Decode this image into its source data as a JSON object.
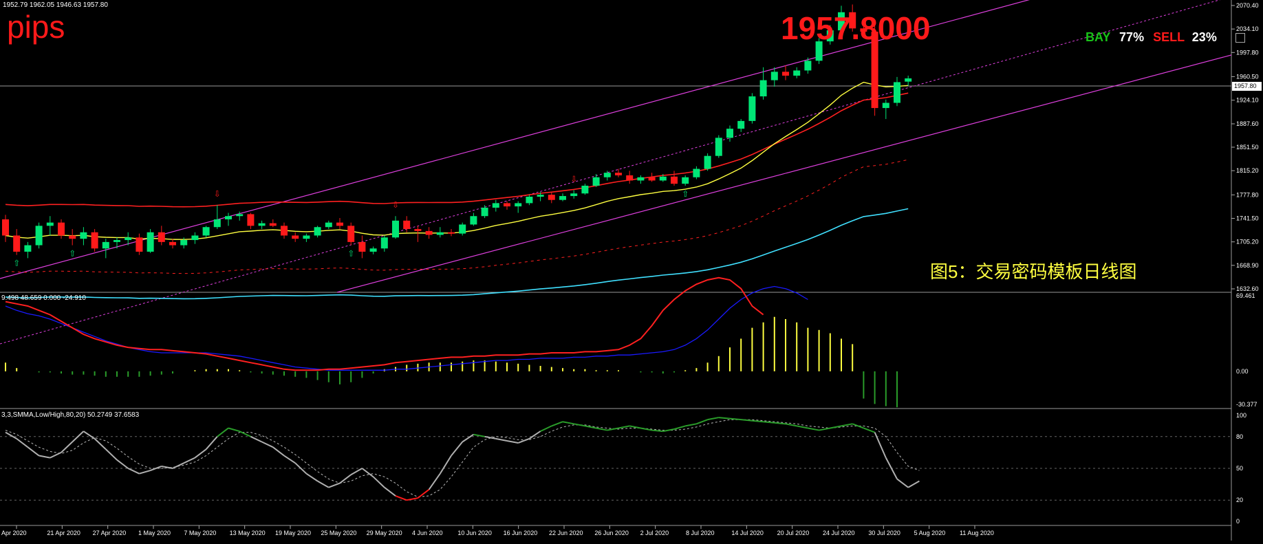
{
  "terminal": {
    "ohlc_readout": "1952.79 1962.05 1946.63 1957.80",
    "pips_label": "pips",
    "big_price": "1957.8000",
    "sentiment": {
      "buy_label": "BAY",
      "buy_pct": "77%",
      "sell_label": "SELL",
      "sell_pct": "23%"
    },
    "caption": "图5：交易密码模板日线图",
    "current_price_tag": "1957.80"
  },
  "colors": {
    "background": "#000000",
    "bull": "#00e676",
    "bear": "#ff1a1a",
    "ma_long": "#ff2020",
    "ma_mid": "#ffff40",
    "ma_low": "#40e0ff",
    "channel": "#e040e0",
    "macd_line": "#1a1aff",
    "signal_line": "#ff2020",
    "stoch_main": "#b0b0b0",
    "stoch_strong": "#2a9d2a",
    "axis_text": "#ffffff"
  },
  "price_axis": {
    "ticks": [
      "2070.40",
      "2034.10",
      "1997.80",
      "1960.50",
      "1924.10",
      "1887.60",
      "1851.50",
      "1815.20",
      "1777.80",
      "1741.50",
      "1705.20",
      "1668.90",
      "1632.60"
    ]
  },
  "macd_panel": {
    "header": "9.498 48.659 0.000 -24.910",
    "ticks": [
      "69.461",
      "0.00",
      "-30.377"
    ]
  },
  "stoch_panel": {
    "header": "3,3,SMMA,Low/High,80,20) 50.2749 37.6583",
    "ticks": [
      "100",
      "80",
      "50",
      "20",
      "0"
    ]
  },
  "date_axis": [
    "Apr 2020",
    "21 Apr 2020",
    "27 Apr 2020",
    "1 May 2020",
    "7 May 2020",
    "13 May 2020",
    "19 May 2020",
    "25 May 2020",
    "29 May 2020",
    "4 Jun 2020",
    "10 Jun 2020",
    "16 Jun 2020",
    "22 Jun 2020",
    "26 Jun 2020",
    "2 Jul 2020",
    "8 Jul 2020",
    "14 Jul 2020",
    "20 Jul 2020",
    "24 Jul 2020",
    "30 Jul 2020",
    "5 Aug 2020",
    "11 Aug 2020"
  ],
  "chart_data": {
    "type": "candlestick",
    "symbol_timeframe": "daily",
    "ylim": [
      1632.6,
      2070.4
    ],
    "candles": [
      {
        "o": 1740,
        "h": 1747,
        "l": 1705,
        "c": 1715
      },
      {
        "o": 1715,
        "h": 1725,
        "l": 1685,
        "c": 1690
      },
      {
        "o": 1690,
        "h": 1705,
        "l": 1680,
        "c": 1700
      },
      {
        "o": 1700,
        "h": 1735,
        "l": 1695,
        "c": 1730
      },
      {
        "o": 1730,
        "h": 1745,
        "l": 1715,
        "c": 1735
      },
      {
        "o": 1735,
        "h": 1740,
        "l": 1710,
        "c": 1715
      },
      {
        "o": 1715,
        "h": 1725,
        "l": 1700,
        "c": 1710
      },
      {
        "o": 1710,
        "h": 1728,
        "l": 1700,
        "c": 1720
      },
      {
        "o": 1720,
        "h": 1725,
        "l": 1690,
        "c": 1695
      },
      {
        "o": 1695,
        "h": 1710,
        "l": 1680,
        "c": 1705
      },
      {
        "o": 1705,
        "h": 1712,
        "l": 1695,
        "c": 1708
      },
      {
        "o": 1708,
        "h": 1720,
        "l": 1700,
        "c": 1712
      },
      {
        "o": 1712,
        "h": 1718,
        "l": 1685,
        "c": 1690
      },
      {
        "o": 1690,
        "h": 1725,
        "l": 1688,
        "c": 1720
      },
      {
        "o": 1720,
        "h": 1730,
        "l": 1700,
        "c": 1705
      },
      {
        "o": 1705,
        "h": 1710,
        "l": 1695,
        "c": 1700
      },
      {
        "o": 1700,
        "h": 1712,
        "l": 1695,
        "c": 1708
      },
      {
        "o": 1708,
        "h": 1720,
        "l": 1702,
        "c": 1715
      },
      {
        "o": 1715,
        "h": 1730,
        "l": 1712,
        "c": 1728
      },
      {
        "o": 1728,
        "h": 1762,
        "l": 1725,
        "c": 1740
      },
      {
        "o": 1740,
        "h": 1750,
        "l": 1730,
        "c": 1745
      },
      {
        "o": 1745,
        "h": 1752,
        "l": 1738,
        "c": 1748
      },
      {
        "o": 1748,
        "h": 1750,
        "l": 1725,
        "c": 1730
      },
      {
        "o": 1730,
        "h": 1738,
        "l": 1725,
        "c": 1734
      },
      {
        "o": 1734,
        "h": 1740,
        "l": 1728,
        "c": 1730
      },
      {
        "o": 1730,
        "h": 1735,
        "l": 1710,
        "c": 1715
      },
      {
        "o": 1715,
        "h": 1720,
        "l": 1705,
        "c": 1710
      },
      {
        "o": 1710,
        "h": 1718,
        "l": 1705,
        "c": 1715
      },
      {
        "o": 1715,
        "h": 1730,
        "l": 1712,
        "c": 1728
      },
      {
        "o": 1728,
        "h": 1738,
        "l": 1725,
        "c": 1735
      },
      {
        "o": 1735,
        "h": 1742,
        "l": 1725,
        "c": 1730
      },
      {
        "o": 1730,
        "h": 1735,
        "l": 1700,
        "c": 1705
      },
      {
        "o": 1705,
        "h": 1715,
        "l": 1680,
        "c": 1690
      },
      {
        "o": 1690,
        "h": 1698,
        "l": 1686,
        "c": 1695
      },
      {
        "o": 1695,
        "h": 1715,
        "l": 1690,
        "c": 1712
      },
      {
        "o": 1712,
        "h": 1745,
        "l": 1710,
        "c": 1738
      },
      {
        "o": 1738,
        "h": 1745,
        "l": 1720,
        "c": 1725
      },
      {
        "o": 1725,
        "h": 1730,
        "l": 1705,
        "c": 1722
      },
      {
        "o": 1722,
        "h": 1728,
        "l": 1710,
        "c": 1716
      },
      {
        "o": 1716,
        "h": 1728,
        "l": 1712,
        "c": 1720
      },
      {
        "o": 1720,
        "h": 1725,
        "l": 1714,
        "c": 1718
      },
      {
        "o": 1718,
        "h": 1735,
        "l": 1715,
        "c": 1732
      },
      {
        "o": 1732,
        "h": 1750,
        "l": 1730,
        "c": 1745
      },
      {
        "o": 1745,
        "h": 1762,
        "l": 1742,
        "c": 1758
      },
      {
        "o": 1758,
        "h": 1770,
        "l": 1752,
        "c": 1765
      },
      {
        "o": 1765,
        "h": 1768,
        "l": 1755,
        "c": 1760
      },
      {
        "o": 1760,
        "h": 1768,
        "l": 1750,
        "c": 1765
      },
      {
        "o": 1765,
        "h": 1778,
        "l": 1762,
        "c": 1775
      },
      {
        "o": 1775,
        "h": 1782,
        "l": 1768,
        "c": 1778
      },
      {
        "o": 1778,
        "h": 1782,
        "l": 1765,
        "c": 1770
      },
      {
        "o": 1770,
        "h": 1780,
        "l": 1768,
        "c": 1776
      },
      {
        "o": 1776,
        "h": 1785,
        "l": 1772,
        "c": 1780
      },
      {
        "o": 1780,
        "h": 1795,
        "l": 1778,
        "c": 1792
      },
      {
        "o": 1792,
        "h": 1810,
        "l": 1790,
        "c": 1805
      },
      {
        "o": 1805,
        "h": 1815,
        "l": 1800,
        "c": 1812
      },
      {
        "o": 1812,
        "h": 1818,
        "l": 1805,
        "c": 1808
      },
      {
        "o": 1808,
        "h": 1815,
        "l": 1795,
        "c": 1800
      },
      {
        "o": 1800,
        "h": 1808,
        "l": 1795,
        "c": 1805
      },
      {
        "o": 1805,
        "h": 1812,
        "l": 1798,
        "c": 1800
      },
      {
        "o": 1800,
        "h": 1810,
        "l": 1798,
        "c": 1806
      },
      {
        "o": 1806,
        "h": 1815,
        "l": 1792,
        "c": 1795
      },
      {
        "o": 1795,
        "h": 1808,
        "l": 1792,
        "c": 1805
      },
      {
        "o": 1805,
        "h": 1822,
        "l": 1802,
        "c": 1818
      },
      {
        "o": 1818,
        "h": 1842,
        "l": 1815,
        "c": 1838
      },
      {
        "o": 1838,
        "h": 1870,
        "l": 1835,
        "c": 1866
      },
      {
        "o": 1866,
        "h": 1885,
        "l": 1860,
        "c": 1880
      },
      {
        "o": 1880,
        "h": 1895,
        "l": 1875,
        "c": 1892
      },
      {
        "o": 1892,
        "h": 1935,
        "l": 1888,
        "c": 1930
      },
      {
        "o": 1930,
        "h": 1975,
        "l": 1925,
        "c": 1955
      },
      {
        "o": 1955,
        "h": 1975,
        "l": 1945,
        "c": 1968
      },
      {
        "o": 1968,
        "h": 1978,
        "l": 1955,
        "c": 1962
      },
      {
        "o": 1962,
        "h": 1975,
        "l": 1958,
        "c": 1970
      },
      {
        "o": 1970,
        "h": 1990,
        "l": 1965,
        "c": 1985
      },
      {
        "o": 1985,
        "h": 2020,
        "l": 1980,
        "c": 2015
      },
      {
        "o": 2015,
        "h": 2040,
        "l": 2010,
        "c": 2032
      },
      {
        "o": 2032,
        "h": 2070,
        "l": 2028,
        "c": 2060
      },
      {
        "o": 2060,
        "h": 2072,
        "l": 2030,
        "c": 2035
      },
      {
        "o": 2035,
        "h": 2050,
        "l": 2025,
        "c": 2030
      },
      {
        "o": 2030,
        "h": 2040,
        "l": 1900,
        "c": 1912
      },
      {
        "o": 1912,
        "h": 1925,
        "l": 1895,
        "c": 1920
      },
      {
        "o": 1920,
        "h": 1960,
        "l": 1915,
        "c": 1952
      },
      {
        "o": 1952.79,
        "h": 1962.05,
        "l": 1946.63,
        "c": 1957.8
      }
    ],
    "macd_bars": [
      8,
      3,
      0,
      -1,
      -1,
      -2,
      -3,
      -3,
      -4,
      -5,
      -5,
      -5,
      -5,
      -4,
      -3,
      -2,
      0,
      1,
      2,
      2,
      2,
      1,
      -1,
      -2,
      -3,
      -4,
      -5,
      -6,
      -8,
      -10,
      -12,
      -10,
      -6,
      -2,
      2,
      4,
      6,
      7,
      8,
      8,
      8,
      9,
      10,
      10,
      9,
      8,
      7,
      6,
      5,
      4,
      3,
      2,
      2,
      1,
      1,
      1,
      0,
      -1,
      -1,
      -2,
      -1,
      1,
      3,
      8,
      14,
      22,
      30,
      40,
      45,
      50,
      48,
      45,
      40,
      38,
      35,
      30,
      25,
      -25,
      -30,
      -32,
      -33
    ],
    "macd_signal": [
      60,
      56,
      53,
      51,
      48,
      44,
      40,
      36,
      32,
      28,
      25,
      22,
      20,
      18,
      17,
      17,
      17,
      17,
      17,
      16,
      15,
      14,
      12,
      10,
      8,
      6,
      4,
      3,
      2,
      1,
      1,
      1,
      1,
      1,
      1,
      2,
      2,
      3,
      4,
      5,
      6,
      7,
      8,
      9,
      10,
      10,
      11,
      11,
      12,
      12,
      12,
      13,
      13,
      14,
      14,
      15,
      15,
      16,
      17,
      18,
      20,
      24,
      30,
      38,
      48,
      58,
      66,
      72,
      76,
      78,
      76,
      72,
      66
    ],
    "macd_line": [
      64,
      62,
      60,
      56,
      52,
      46,
      40,
      34,
      30,
      27,
      24,
      22,
      21,
      20,
      20,
      19,
      18,
      17,
      16,
      14,
      12,
      10,
      8,
      6,
      4,
      2,
      1,
      1,
      1,
      2,
      2,
      3,
      4,
      5,
      6,
      8,
      9,
      10,
      11,
      12,
      13,
      13,
      14,
      14,
      15,
      15,
      15,
      16,
      16,
      17,
      17,
      17,
      18,
      18,
      19,
      20,
      24,
      30,
      42,
      56,
      66,
      74,
      80,
      84,
      86,
      84,
      76,
      60,
      52
    ],
    "stoch_main": [
      84,
      78,
      70,
      62,
      60,
      65,
      75,
      85,
      78,
      68,
      58,
      50,
      45,
      48,
      52,
      50,
      55,
      60,
      68,
      80,
      88,
      85,
      80,
      75,
      70,
      62,
      55,
      45,
      38,
      32,
      36,
      44,
      50,
      42,
      32,
      24,
      20,
      22,
      30,
      45,
      62,
      75,
      82,
      80,
      78,
      76,
      74,
      78,
      85,
      90,
      94,
      92,
      90,
      88,
      86,
      88,
      90,
      88,
      86,
      85,
      87,
      90,
      92,
      96,
      98,
      97,
      96,
      95,
      94,
      93,
      92,
      90,
      88,
      86,
      88,
      90,
      92,
      88,
      84,
      60,
      40,
      32,
      38
    ],
    "stoch_signal": [
      86,
      82,
      76,
      70,
      66,
      64,
      67,
      74,
      79,
      76,
      69,
      61,
      54,
      50,
      50,
      51,
      53,
      56,
      62,
      70,
      78,
      84,
      84,
      81,
      76,
      70,
      63,
      55,
      47,
      40,
      36,
      38,
      43,
      45,
      42,
      36,
      28,
      23,
      24,
      30,
      42,
      56,
      70,
      77,
      80,
      79,
      77,
      77,
      80,
      85,
      89,
      91,
      91,
      89,
      88,
      87,
      88,
      88,
      87,
      86,
      86,
      87,
      89,
      92,
      94,
      96,
      96,
      96,
      95,
      94,
      93,
      92,
      90,
      89,
      88,
      89,
      90,
      90,
      88,
      80,
      65,
      52,
      48
    ]
  }
}
